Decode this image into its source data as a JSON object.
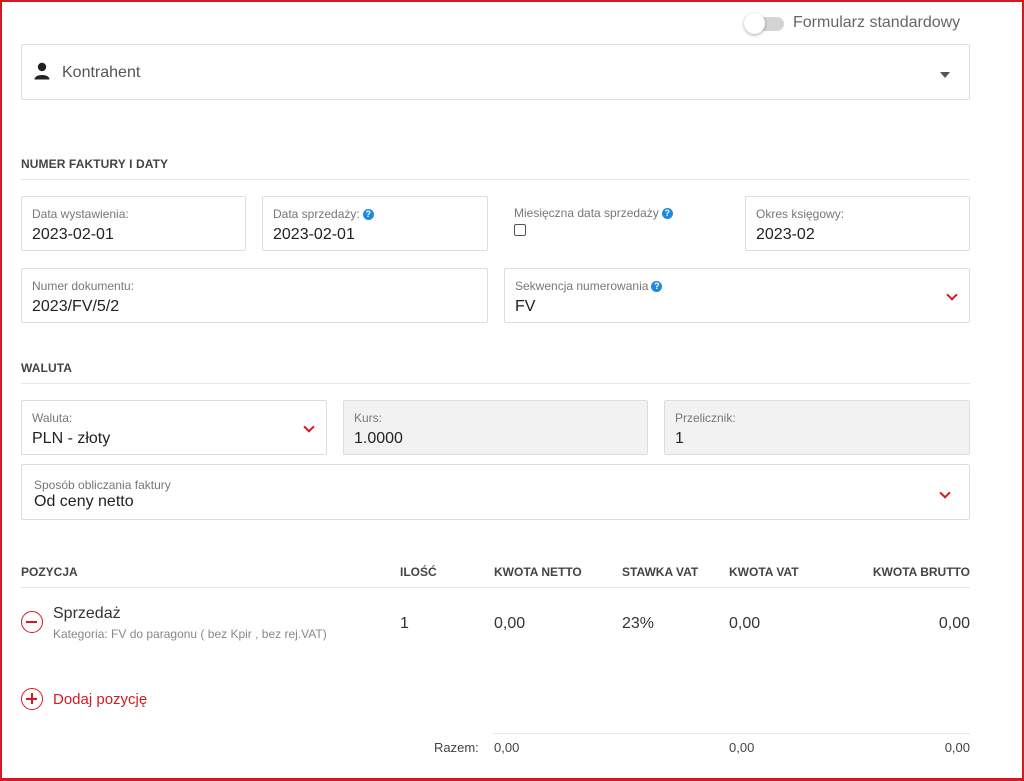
{
  "toggle": {
    "label": "Formularz standardowy",
    "on": false
  },
  "contractor": {
    "placeholder": "Kontrahent",
    "icon": "user-icon"
  },
  "invoice_section": {
    "title": "NUMER FAKTURY I DATY",
    "issue_date": {
      "label": "Data wystawienia:",
      "value": "2023-02-01"
    },
    "sale_date": {
      "label": "Data sprzedaży:",
      "value": "2023-02-01"
    },
    "monthly_sale_date": {
      "label": "Miesięczna data sprzedaży",
      "checked": false
    },
    "accounting_period": {
      "label": "Okres księgowy:",
      "value": "2023-02"
    },
    "document_number": {
      "label": "Numer dokumentu:",
      "value": "2023/FV/5/2"
    },
    "numbering_sequence": {
      "label": "Sekwencja numerowania",
      "value": "FV"
    }
  },
  "currency_section": {
    "title": "WALUTA",
    "currency": {
      "label": "Waluta:",
      "value": "PLN - złoty"
    },
    "rate": {
      "label": "Kurs:",
      "value": "1.0000"
    },
    "converter": {
      "label": "Przelicznik:",
      "value": "1"
    },
    "calc_method": {
      "label": "Sposób obliczania faktury",
      "value": "Od ceny netto"
    }
  },
  "positions": {
    "headers": {
      "position": "POZYCJA",
      "qty": "ILOŚĆ",
      "net": "KWOTA NETTO",
      "vat_rate": "STAWKA VAT",
      "vat": "KWOTA VAT",
      "gross": "KWOTA BRUTTO"
    },
    "rows": [
      {
        "name": "Sprzedaż",
        "category": "Kategoria: FV do paragonu ( bez Kpir , bez rej.VAT)",
        "qty": "1",
        "net": "0,00",
        "vat_rate": "23%",
        "vat": "0,00",
        "gross": "0,00"
      }
    ],
    "add_label": "Dodaj pozycję",
    "totals": {
      "label": "Razem:",
      "net": "0,00",
      "vat": "0,00",
      "gross": "0,00"
    }
  },
  "colors": {
    "accent": "#d61920",
    "help": "#1e88e5"
  }
}
